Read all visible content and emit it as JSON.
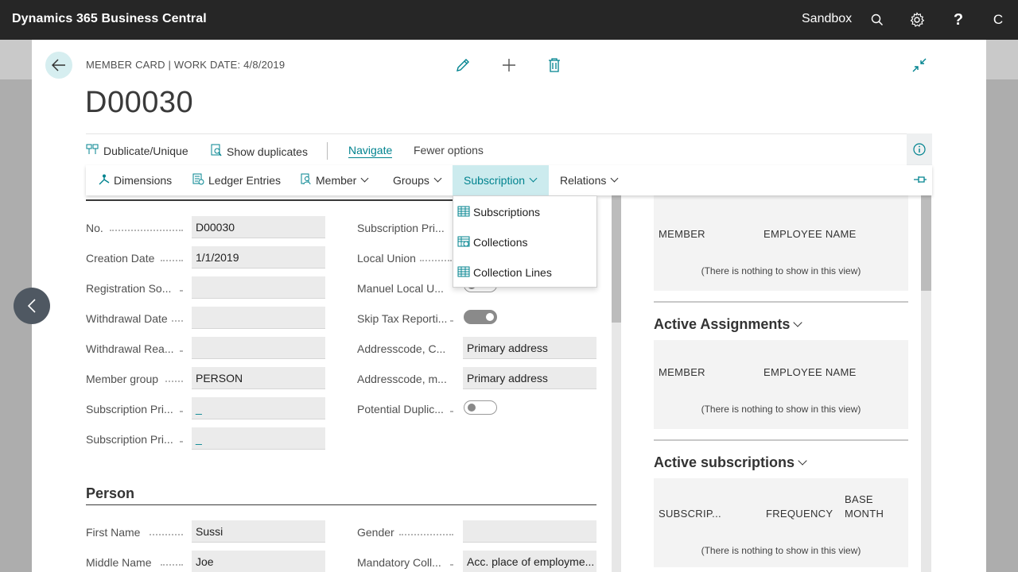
{
  "topbar": {
    "app_title": "Dynamics 365 Business Central",
    "environment": "Sandbox",
    "avatar_initial": "C"
  },
  "page": {
    "caption": "MEMBER CARD | WORK DATE: 4/8/2019",
    "record_title": "D00030"
  },
  "actions": {
    "duplicate": "Dublicate/Unique",
    "show_duplicates": "Show duplicates",
    "navigate": "Navigate",
    "fewer_options": "Fewer options"
  },
  "navigate_menu": {
    "items": [
      "Dimensions",
      "Ledger Entries",
      "Member",
      "Groups",
      "Subscription",
      "Relations"
    ],
    "active": "Subscription"
  },
  "subscription_dropdown": [
    "Subscriptions",
    "Collections",
    "Collection Lines"
  ],
  "general": {
    "left": [
      {
        "label": "No.",
        "value": "D00030"
      },
      {
        "label": "Creation Date",
        "value": "1/1/2019"
      },
      {
        "label": "Registration So...",
        "value": ""
      },
      {
        "label": "Withdrawal Date",
        "value": ""
      },
      {
        "label": "Withdrawal Rea...",
        "value": ""
      },
      {
        "label": "Member group",
        "value": "PERSON"
      },
      {
        "label": "Subscription Pri...",
        "value": "_"
      },
      {
        "label": "Subscription Pri...",
        "value": "_"
      }
    ],
    "right": [
      {
        "label": "Subscription Pri...",
        "value": ""
      },
      {
        "label": "Local Union",
        "value": ""
      },
      {
        "label": "Manuel Local U...",
        "toggle": false
      },
      {
        "label": "Skip Tax Reporti...",
        "toggle": true
      },
      {
        "label": "Addresscode, C...",
        "value": "Primary address"
      },
      {
        "label": "Addresscode, m...",
        "value": "Primary address"
      },
      {
        "label": "Potential Duplic...",
        "toggle": false
      }
    ]
  },
  "person": {
    "title": "Person",
    "left": [
      {
        "label": "First Name",
        "value": "Sussi"
      },
      {
        "label": "Middle Name",
        "value": "Joe"
      }
    ],
    "right": [
      {
        "label": "Gender",
        "value": ""
      },
      {
        "label": "Mandatory Coll...",
        "value": "Acc. place of employme..."
      }
    ]
  },
  "factbox": {
    "first": {
      "col1": "MEMBER",
      "col2": "EMPLOYEE NAME",
      "empty": "(There is nothing to show in this view)"
    },
    "active_assignments": {
      "title": "Active Assignments",
      "col1": "MEMBER",
      "col2": "EMPLOYEE NAME",
      "empty": "(There is nothing to show in this view)"
    },
    "active_subscriptions": {
      "title": "Active subscriptions",
      "col1": "SUBSCRIP...",
      "col2": "FREQUENCY",
      "col3_line1": "BASE",
      "col3_line2": "MONTH",
      "empty": "(There is nothing to show in this view)"
    }
  },
  "colors": {
    "accent": "#00838f",
    "topbar": "#262626",
    "field_bg": "#ebebeb"
  }
}
